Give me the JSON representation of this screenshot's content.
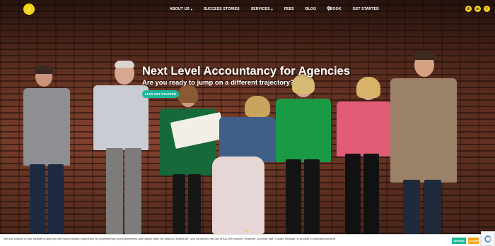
{
  "header": {
    "logo_glyph": "♪",
    "nav": [
      {
        "label": "ABOUT US",
        "has_dropdown": true
      },
      {
        "label": "SUCCESS STORIES",
        "has_dropdown": false
      },
      {
        "label": "SERVICES",
        "has_dropdown": true
      },
      {
        "label": "FEES",
        "has_dropdown": false
      },
      {
        "label": "BLOG",
        "has_dropdown": false
      },
      {
        "label": "EBOOK",
        "has_dropdown": false
      },
      {
        "label": "GET STARTED",
        "has_dropdown": false
      }
    ],
    "search_glyph": "⚲",
    "social": [
      {
        "icon": "phone-icon",
        "glyph": "✆"
      },
      {
        "icon": "linkedin-icon",
        "glyph": "in"
      },
      {
        "icon": "facebook-icon",
        "glyph": "f"
      }
    ]
  },
  "hero": {
    "headline": "Next Level Accountancy for Agencies",
    "subheadline": "Are you ready to jump on a different trajectory?",
    "cta_label": "LETS GET STARTED",
    "scroll_glyph": "⌄"
  },
  "cookie": {
    "text": "We use cookies on our website to give you the most relevant experience by remembering your preferences and repeat visits. By clicking \"Accept All\", you consent to the use of ALL the cookies. However, you may visit \"Cookie Settings\" to provide a controlled consent.",
    "settings_label": "Settings",
    "accept_label": "Accept All"
  },
  "colors": {
    "accent_yellow": "#f7d21a",
    "accent_teal": "#1fb79a",
    "accept_orange": "#f7a21a"
  }
}
